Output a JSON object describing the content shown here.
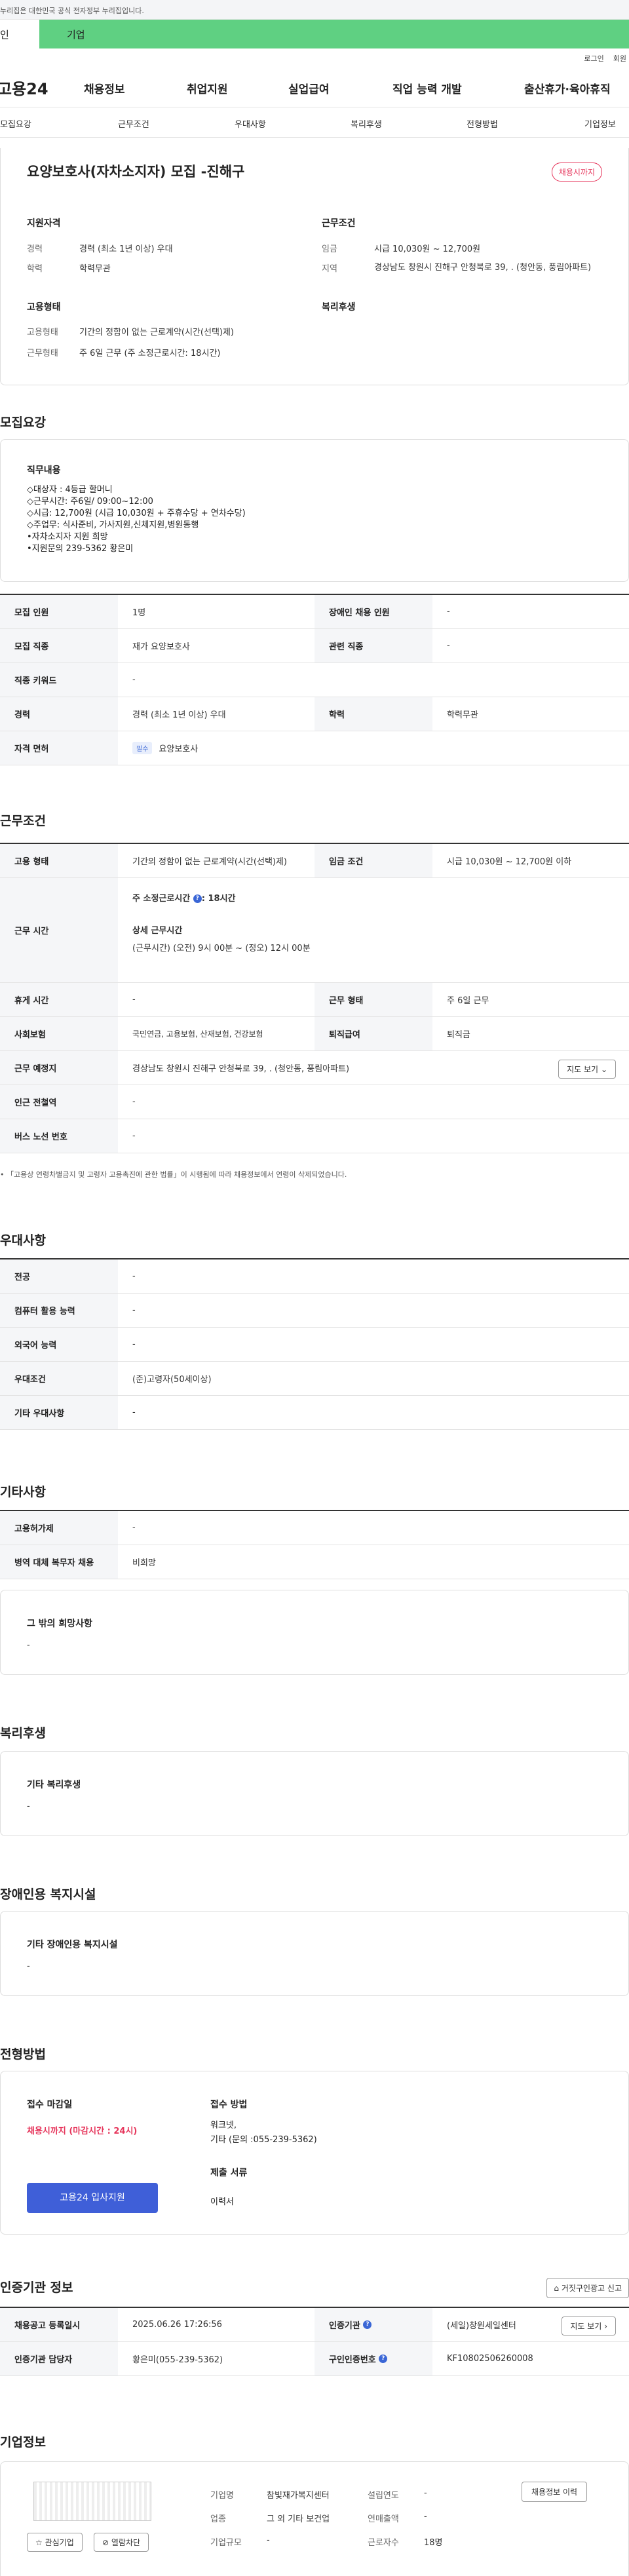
{
  "gov_banner": "누리집은 대한민국 공식 전자정부 누리집입니다.",
  "user_tabs": {
    "individual": "인",
    "business": "기업"
  },
  "util_links": {
    "login": "로그인",
    "join": "회원"
  },
  "gnb": {
    "logo": "고용24",
    "items": [
      "채용정보",
      "취업지원",
      "실업급여",
      "직업 능력 개발",
      "출산휴가·육아휴직"
    ]
  },
  "anchors": [
    "모집요강",
    "근무조건",
    "우대사항",
    "복리후생",
    "전형방법",
    "기업정보"
  ],
  "summary": {
    "title": "요양보호사(자차소지자) 모집 -진해구",
    "badge": "채용시까지",
    "qual_heading": "지원자격",
    "career_label": "경력",
    "career_value": "경력 (최소 1년 이상) 우대",
    "edu_label": "학력",
    "edu_value": "학력무관",
    "cond_heading": "근무조건",
    "wage_label": "임금",
    "wage_value": "시급 10,030원 ~ 12,700원",
    "region_label": "지역",
    "region_value": "경상남도 창원시 진해구 안청북로 39, . (청안동, 풍림아파트)",
    "emp_heading": "고용형태",
    "emptype_label": "고용형태",
    "emptype_value": "기간의 정함이 없는 근로계약(시간(선택)제)",
    "worktype_label": "근무형태",
    "worktype_value": "주 6일 근무 (주 소정근로시간: 18시간)",
    "welfare_heading": "복리후생"
  },
  "recruit": {
    "heading": "모집요강",
    "duty_title": "직무내용",
    "duty_lines": [
      "◇대상자 : 4등급 할머니",
      "◇근무시간: 주6일/ 09:00~12:00",
      "◇시급: 12,700원 (시급 10,030원 + 주휴수당 + 연차수당)",
      "◇주업무: 식사준비, 가사지원,신체지원,병원동행",
      "•자차소지자 지원 희망",
      "•지원문의 239-5362 황은미"
    ],
    "rows": [
      [
        "모집 인원",
        "1명",
        "장애인 채용 인원",
        "-"
      ],
      [
        "모집 직종",
        "재가 요양보호사",
        "관련 직종",
        "-"
      ],
      [
        "직종 키워드",
        "-",
        "",
        ""
      ],
      [
        "경력",
        "경력 (최소 1년 이상) 우대",
        "학력",
        "학력무관"
      ]
    ],
    "license_label": "자격 면허",
    "license_tag": "필수",
    "license_value": "요양보호사"
  },
  "conditions": {
    "heading": "근무조건",
    "emp_label": "고용 형태",
    "emp_value": "기간의 정함이 없는 근로계약(시간(선택)제)",
    "wage_label": "임금 조건",
    "wage_value": "시급 10,030원 ~ 12,700원 이하",
    "hours_label": "근무 시간",
    "hours_main": "주 소정근로시간",
    "hours_main_val": ": 18시간",
    "hours_detail_title": "상세 근무시간",
    "hours_detail": "(근무시간) (오전) 9시 00분 ~ (정오) 12시 00분",
    "rows": [
      [
        "휴게 시간",
        "-",
        "근무 형태",
        "주 6일 근무"
      ],
      [
        "사회보험",
        "국민연금, 고용보험, 산재보험, 건강보험",
        "퇴직급여",
        "퇴직금"
      ]
    ],
    "place_label": "근무 예정지",
    "place_value": "경상남도 창원시 진해구 안청북로 39, . (청안동, 풍림아파트)",
    "map_btn": "지도 보기",
    "station_label": "인근 전철역",
    "station_value": "-",
    "bus_label": "버스 노선 번호",
    "bus_value": "-",
    "note": "「고용상 연령차별금지 및 고령자 고용촉진에 관한 법률」이 시행됨에 따라 채용정보에서 연령이 삭제되었습니다."
  },
  "preference": {
    "heading": "우대사항",
    "rows": [
      [
        "전공",
        "-"
      ],
      [
        "컴퓨터 활용 능력",
        "-"
      ],
      [
        "외국어 능력",
        "-"
      ],
      [
        "우대조건",
        "(준)고령자(50세이상)"
      ],
      [
        "기타 우대사항",
        "-"
      ]
    ]
  },
  "etc": {
    "heading": "기타사항",
    "rows": [
      [
        "고용허가제",
        "-"
      ],
      [
        "병역 대체 복무자 채용",
        "비희망"
      ]
    ],
    "other_title": "그 밖의 희망사항",
    "other_value": "-"
  },
  "welfare": {
    "heading": "복리후생",
    "title": "기타 복리후생",
    "value": "-"
  },
  "disabled": {
    "heading": "장애인용 복지시설",
    "title": "기타 장애인용 복지시설",
    "value": "-"
  },
  "process": {
    "heading": "전형방법",
    "deadline_title": "접수 마감일",
    "deadline_value": "채용시까지 (마감시간 : 24시)",
    "apply_btn": "고용24 입사지원",
    "method_title": "접수 방법",
    "method_lines": [
      "워크넷,",
      "기타 (문의 :055-239-5362)"
    ],
    "docs_title": "제출 서류",
    "docs_value": "이력서"
  },
  "agency": {
    "heading": "인증기관 정보",
    "report_btn": "거짓구인광고 신고",
    "reg_label": "채용공고 등록일시",
    "reg_value": "2025.06.26 17:26:56",
    "org_label": "인증기관",
    "org_value": "(세일)창원세일센터",
    "map_btn": "지도 보기",
    "staff_label": "인증기관 담당자",
    "staff_value": "황은미(055-239-5362)",
    "no_label": "구인인증번호",
    "no_value": "KF10802506260008"
  },
  "company": {
    "heading": "기업정보",
    "interest_btn": "관심기업",
    "block_btn": "열람차단",
    "name_label": "기업명",
    "name_value": "참빛재가복지센터",
    "est_label": "설립연도",
    "est_value": "-",
    "biz_label": "업종",
    "biz_value": "그 외 기타 보건업",
    "sales_label": "연매출액",
    "sales_value": "-",
    "size_label": "기업규모",
    "size_value": "-",
    "emp_label": "근로자수",
    "emp_value": "18명",
    "history_btn": "채용정보 이력"
  },
  "colors": {
    "green": "#5fd082",
    "accent_red": "#e6355b",
    "apply_blue": "#3f5fd8"
  }
}
